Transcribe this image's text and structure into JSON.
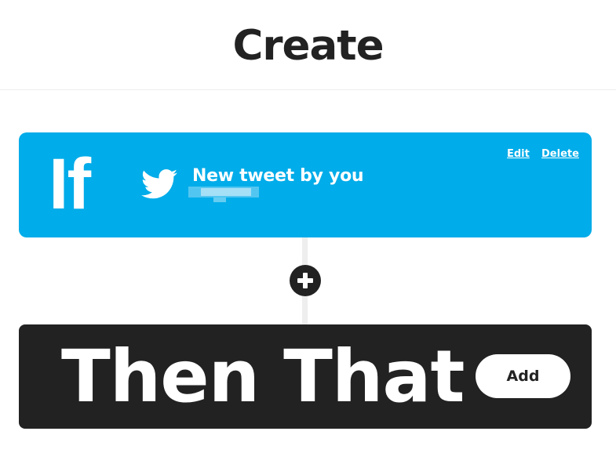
{
  "header": {
    "title": "Create"
  },
  "trigger": {
    "label": "If",
    "service_icon": "twitter-bird-icon",
    "title": "New tweet by you",
    "edit_label": "Edit",
    "delete_label": "Delete",
    "color": "#00ace9"
  },
  "connector": {
    "icon": "plus-icon"
  },
  "action": {
    "label": "Then That",
    "add_label": "Add",
    "color": "#222222"
  }
}
